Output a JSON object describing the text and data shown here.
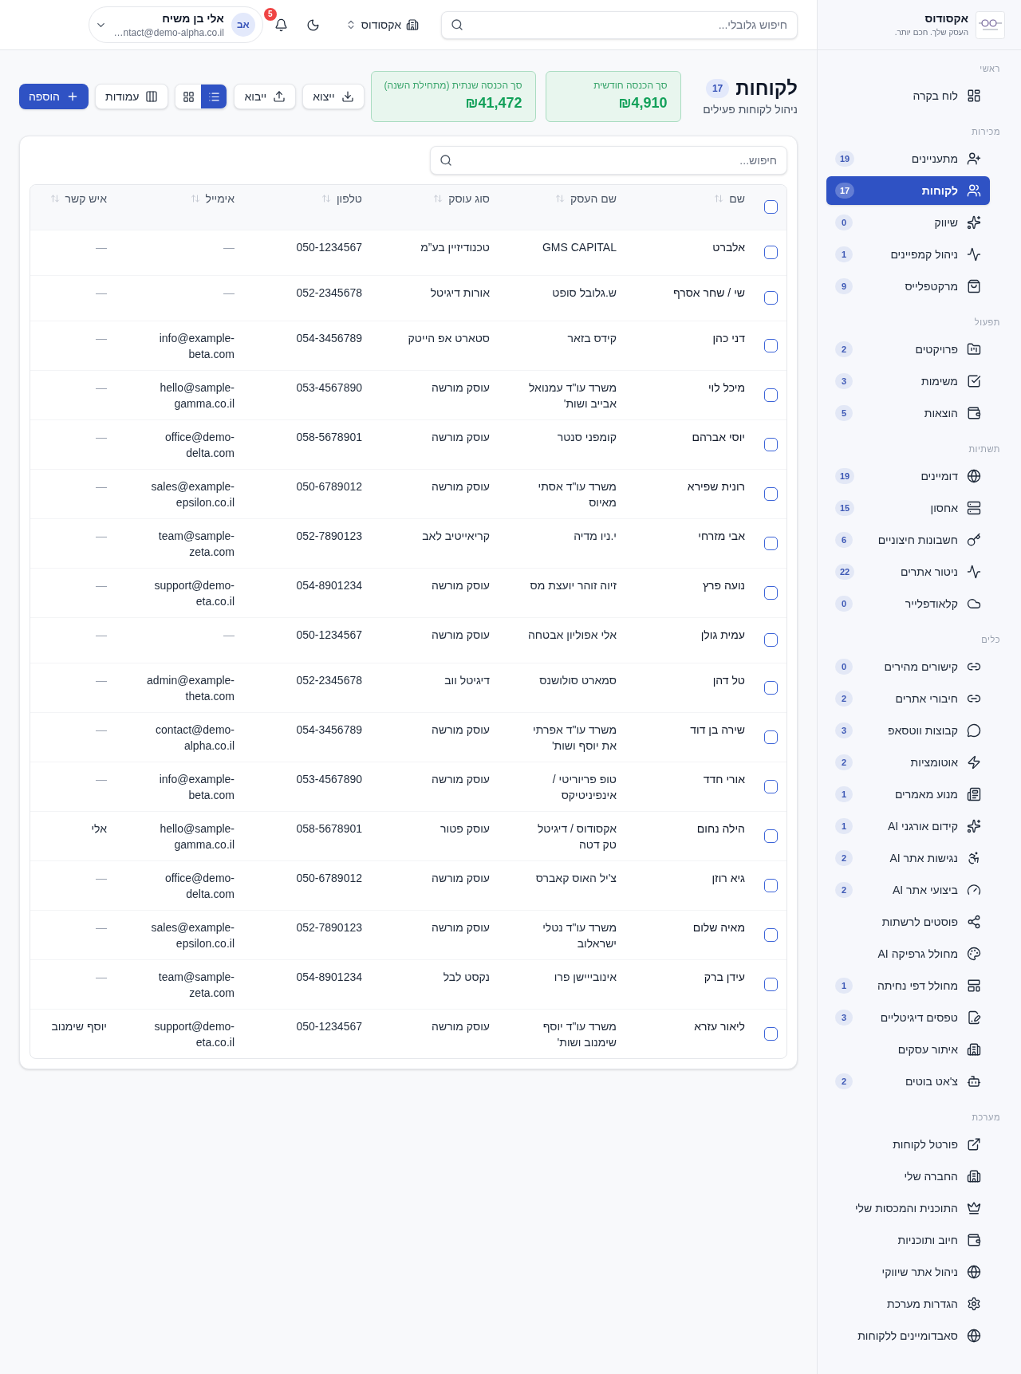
{
  "sidebar": {
    "brand": {
      "name": "אקסודוס",
      "tagline": "העסק שלך. חכם יותר."
    },
    "sections": [
      {
        "label": "ראשי",
        "items": [
          {
            "label": "לוח בקרה",
            "selected": false
          }
        ]
      },
      {
        "label": "מכירות",
        "items": [
          {
            "label": "מתעניינים",
            "badge": "19",
            "selected": false
          },
          {
            "label": "לקוחות",
            "badge": "17",
            "selected": true
          },
          {
            "label": "שיווק",
            "badge": "0",
            "selected": false
          },
          {
            "label": "ניהול קמפיינים",
            "badge": "1",
            "selected": false
          },
          {
            "label": "מרקטפלייס",
            "badge": "9",
            "selected": false
          }
        ]
      },
      {
        "label": "תפעול",
        "items": [
          {
            "label": "פרויקטים",
            "badge": "2",
            "selected": false
          },
          {
            "label": "משימות",
            "badge": "3",
            "selected": false
          },
          {
            "label": "הוצאות",
            "badge": "5",
            "selected": false
          }
        ]
      },
      {
        "label": "תשתיות",
        "items": [
          {
            "label": "דומיינים",
            "badge": "19",
            "selected": false
          },
          {
            "label": "אחסון",
            "badge": "15",
            "selected": false
          },
          {
            "label": "חשבונות חיצוניים",
            "badge": "6",
            "selected": false
          },
          {
            "label": "ניטור אתרים",
            "badge": "22",
            "selected": false
          },
          {
            "label": "קלאודפלייר",
            "badge": "0",
            "selected": false
          }
        ]
      },
      {
        "label": "כלים",
        "items": [
          {
            "label": "קישורים מהירים",
            "badge": "0",
            "selected": false
          },
          {
            "label": "חיבורי אתרים",
            "badge": "2",
            "selected": false
          },
          {
            "label": "קבוצות ווטסאפ",
            "badge": "3",
            "selected": false
          },
          {
            "label": "אוטומציות",
            "badge": "2",
            "selected": false
          },
          {
            "label": "מנוע מאמרים",
            "badge": "1",
            "selected": false
          },
          {
            "label": "קידום אורגני AI",
            "badge": "1",
            "selected": false
          },
          {
            "label": "נגישות אתר AI",
            "badge": "2",
            "selected": false
          },
          {
            "label": "ביצועי אתר AI",
            "badge": "2",
            "selected": false
          },
          {
            "label": "פוסטים לרשתות",
            "selected": false
          },
          {
            "label": "מחולל גרפיקה AI",
            "selected": false
          },
          {
            "label": "מחולל דפי נחיתה",
            "badge": "1",
            "selected": false
          },
          {
            "label": "טפסים דיגיטליים",
            "badge": "3",
            "selected": false
          },
          {
            "label": "איתור עסקים",
            "selected": false
          },
          {
            "label": "צ'אט בוטים",
            "badge": "2",
            "selected": false
          }
        ]
      },
      {
        "label": "מערכת",
        "items": [
          {
            "label": "פורטל לקוחות",
            "selected": false
          },
          {
            "label": "החברה שלי",
            "selected": false
          },
          {
            "label": "התוכנית והמכסות שלי",
            "selected": false
          },
          {
            "label": "חיוב ותוכניות",
            "selected": false
          },
          {
            "label": "ניהול אתר שיווקי",
            "selected": false
          },
          {
            "label": "הגדרות מערכת",
            "selected": false
          },
          {
            "label": "סאבדומיינים ללקוחות",
            "selected": false
          }
        ]
      }
    ]
  },
  "topbar": {
    "search": {
      "placeholder": "חיפוש גלובלי..."
    },
    "company": "אקסודוס",
    "notifications": "5",
    "user": {
      "initials": "אב",
      "name": "אלי בן משיח",
      "email": "…ntact@demo-alpha.co.il"
    }
  },
  "page": {
    "title": "לקוחות",
    "count": "17",
    "subtitle": "ניהול לקוחות פעילים",
    "stats": [
      {
        "label": "סך הכנסה חודשית",
        "value": "₪4,910"
      },
      {
        "label": "סך הכנסה שנתית (מתחילת השנה)",
        "value": "₪41,472"
      }
    ],
    "actions": [
      {
        "kind": "export",
        "label": "ייצוא"
      },
      {
        "kind": "import",
        "label": "ייבוא"
      }
    ],
    "view_toggle": [
      {
        "kind": "list",
        "selected": true
      },
      {
        "kind": "grid",
        "selected": false
      }
    ],
    "columns_button": "עמודות",
    "add_button": "הוספה"
  },
  "table": {
    "search": {
      "placeholder": "חיפוש..."
    },
    "select_all": {
      "checked": false
    },
    "columns": [
      "שם",
      "שם העסק",
      "סוג עוסק",
      "טלפון",
      "אימייל",
      "איש קשר"
    ],
    "rows": [
      {
        "checked": false,
        "name": "אלברט",
        "business": "GMS CAPITAL",
        "type": "טכנודיזיין בע”מ",
        "phone": "050-1234567",
        "email": {
          "text": "—",
          "empty": true
        },
        "contact": {
          "text": "—",
          "empty": true
        }
      },
      {
        "checked": false,
        "name": "שי / שחר אסרף",
        "business": "ש.גלובל סופט",
        "type": "אורות דיגיטל",
        "phone": "052-2345678",
        "email": {
          "text": "—",
          "empty": true
        },
        "contact": {
          "text": "—",
          "empty": true
        }
      },
      {
        "checked": false,
        "name": "דני כהן",
        "business": "קידס בזאר",
        "type": "סטארט אפ הייטק",
        "phone": "054-3456789",
        "email": {
          "text": "info@example-beta.com",
          "empty": false
        },
        "contact": {
          "text": "—",
          "empty": true
        }
      },
      {
        "checked": false,
        "name": "מיכל לוי",
        "business": "משרד עו\"ד עמנואל אבייב ושות'",
        "type": "עוסק מורשה",
        "phone": "053-4567890",
        "email": {
          "text": "hello@sample-gamma.co.il",
          "empty": false
        },
        "contact": {
          "text": "—",
          "empty": true
        }
      },
      {
        "checked": false,
        "name": "יוסי אברהם",
        "business": "קומפני סנטר",
        "type": "עוסק מורשה",
        "phone": "058-5678901",
        "email": {
          "text": "office@demo-delta.com",
          "empty": false
        },
        "contact": {
          "text": "—",
          "empty": true
        }
      },
      {
        "checked": false,
        "name": "רונית שפירא",
        "business": "משרד עו\"ד אסתי מאיוס",
        "type": "עוסק מורשה",
        "phone": "050-6789012",
        "email": {
          "text": "sales@example-epsilon.co.il",
          "empty": false
        },
        "contact": {
          "text": "—",
          "empty": true
        }
      },
      {
        "checked": false,
        "name": "אבי מזרחי",
        "business": "י.ניו מדיה",
        "type": "קריאייטיב לאב",
        "phone": "052-7890123",
        "email": {
          "text": "team@sample-zeta.com",
          "empty": false
        },
        "contact": {
          "text": "—",
          "empty": true
        }
      },
      {
        "checked": false,
        "name": "נועה פרץ",
        "business": "זיוה זוהר יועצת מס",
        "type": "עוסק מורשה",
        "phone": "054-8901234",
        "email": {
          "text": "support@demo-eta.co.il",
          "empty": false
        },
        "contact": {
          "text": "—",
          "empty": true
        }
      },
      {
        "checked": false,
        "name": "עמית גולן",
        "business": "אלי אפוליון אבטחה",
        "type": "עוסק מורשה",
        "phone": "050-1234567",
        "email": {
          "text": "—",
          "empty": true
        },
        "contact": {
          "text": "—",
          "empty": true
        }
      },
      {
        "checked": false,
        "name": "טל דהן",
        "business": "סמארט סולושנס",
        "type": "דיגיטל ווב",
        "phone": "052-2345678",
        "email": {
          "text": "admin@example-theta.com",
          "empty": false
        },
        "contact": {
          "text": "—",
          "empty": true
        }
      },
      {
        "checked": false,
        "name": "שירה בן דוד",
        "business": "משרד עו\"ד אפרתי את יוסף ושות'",
        "type": "עוסק מורשה",
        "phone": "054-3456789",
        "email": {
          "text": "contact@demo-alpha.co.il",
          "empty": false
        },
        "contact": {
          "text": "—",
          "empty": true
        }
      },
      {
        "checked": false,
        "name": "אורי חדד",
        "business": "טופ פריוריטי / אינפיניטיקס",
        "type": "עוסק מורשה",
        "phone": "053-4567890",
        "email": {
          "text": "info@example-beta.com",
          "empty": false
        },
        "contact": {
          "text": "—",
          "empty": true
        }
      },
      {
        "checked": false,
        "name": "הילה נחום",
        "business": "אקסודוס / דיגיטל טק דטה",
        "type": "עוסק פטור",
        "phone": "058-5678901",
        "email": {
          "text": "hello@sample-gamma.co.il",
          "empty": false
        },
        "contact": {
          "text": "אלי",
          "empty": false
        }
      },
      {
        "checked": false,
        "name": "גיא רוזן",
        "business": "צ'יל האוס קאברס",
        "type": "עוסק מורשה",
        "phone": "050-6789012",
        "email": {
          "text": "office@demo-delta.com",
          "empty": false
        },
        "contact": {
          "text": "—",
          "empty": true
        }
      },
      {
        "checked": false,
        "name": "מאיה שלום",
        "business": "משרד עו\"ד נטלי ישראלוב",
        "type": "עוסק מורשה",
        "phone": "052-7890123",
        "email": {
          "text": "sales@example-epsilon.co.il",
          "empty": false
        },
        "contact": {
          "text": "—",
          "empty": true
        }
      },
      {
        "checked": false,
        "name": "עידן ברק",
        "business": "אינובייישן פרו",
        "type": "נקסט לבל",
        "phone": "054-8901234",
        "email": {
          "text": "team@sample-zeta.com",
          "empty": false
        },
        "contact": {
          "text": "—",
          "empty": true
        }
      },
      {
        "checked": false,
        "name": "ליאור עזרא",
        "business": "משרד עו\"ד יוסף שימנוב ושות'",
        "type": "עוסק מורשה",
        "phone": "050-1234567",
        "email": {
          "text": "support@demo-eta.co.il",
          "empty": false
        },
        "contact": {
          "text": "יוסף שימנוב",
          "empty": false
        }
      }
    ]
  }
}
